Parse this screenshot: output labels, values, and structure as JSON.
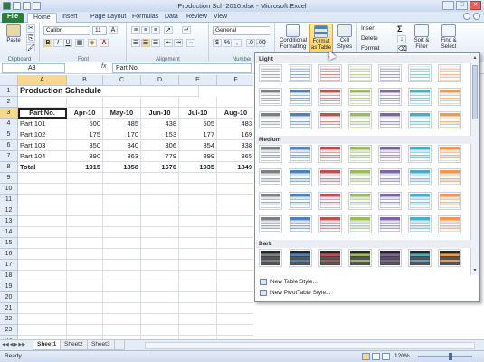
{
  "window": {
    "title": "Production Sch 2010.xlsx - Microsoft Excel",
    "minimize": "–",
    "maximize": "□",
    "close": "✕"
  },
  "tabs": [
    "File",
    "Home",
    "Insert",
    "Page Layout",
    "Formulas",
    "Data",
    "Review",
    "View"
  ],
  "ribbon": {
    "paste": "Paste",
    "clipboard": "Clipboard",
    "font_name": "Calibri",
    "font_size": "11",
    "bold": "B",
    "italic": "I",
    "underline": "U",
    "font": "Font",
    "alignment": "Alignment",
    "number_format": "General",
    "number": "Number",
    "conditional_formatting": "Conditional Formatting",
    "format_as_table": "Format as Table",
    "cell_styles": "Cell Styles",
    "insert": "Insert",
    "delete": "Delete",
    "format": "Format",
    "sort_filter": "Sort & Filter",
    "find_select": "Find & Select",
    "autosum": "Σ"
  },
  "formula_bar": {
    "name_box": "A3",
    "fx": "fx",
    "value": "Part No."
  },
  "columns": [
    "A",
    "B",
    "C",
    "D",
    "E",
    "F"
  ],
  "rows": [
    "1",
    "2",
    "3",
    "4",
    "5",
    "6",
    "7",
    "8",
    "9",
    "10",
    "11",
    "12",
    "13",
    "14",
    "15",
    "16",
    "17",
    "18",
    "19",
    "20",
    "21",
    "22",
    "23",
    "24"
  ],
  "sheet": {
    "title": "Production Schedule",
    "headers": [
      "Part No.",
      "Apr-10",
      "May-10",
      "Jun-10",
      "Jul-10",
      "Aug-10"
    ],
    "data": [
      [
        "Part 101",
        "500",
        "485",
        "438",
        "505",
        "483"
      ],
      [
        "Part 102",
        "175",
        "170",
        "153",
        "177",
        "169"
      ],
      [
        "Part 103",
        "350",
        "340",
        "306",
        "354",
        "338"
      ],
      [
        "Part 104",
        "890",
        "863",
        "779",
        "899",
        "865"
      ]
    ],
    "total": [
      "Total",
      "1915",
      "1858",
      "1676",
      "1935",
      "1849"
    ]
  },
  "gallery": {
    "sections": [
      "Light",
      "Medium",
      "Dark"
    ],
    "new_table_style": "New Table Style...",
    "new_pivot_style": "New PivotTable Style...",
    "palette": [
      "#7f7f7f",
      "#4f81bd",
      "#c0504d",
      "#9bbb59",
      "#8064a2",
      "#4bacc6",
      "#f79646"
    ]
  },
  "sheet_tabs": [
    "Sheet1",
    "Sheet2",
    "Sheet3"
  ],
  "status": {
    "ready": "Ready",
    "zoom": "120%"
  }
}
